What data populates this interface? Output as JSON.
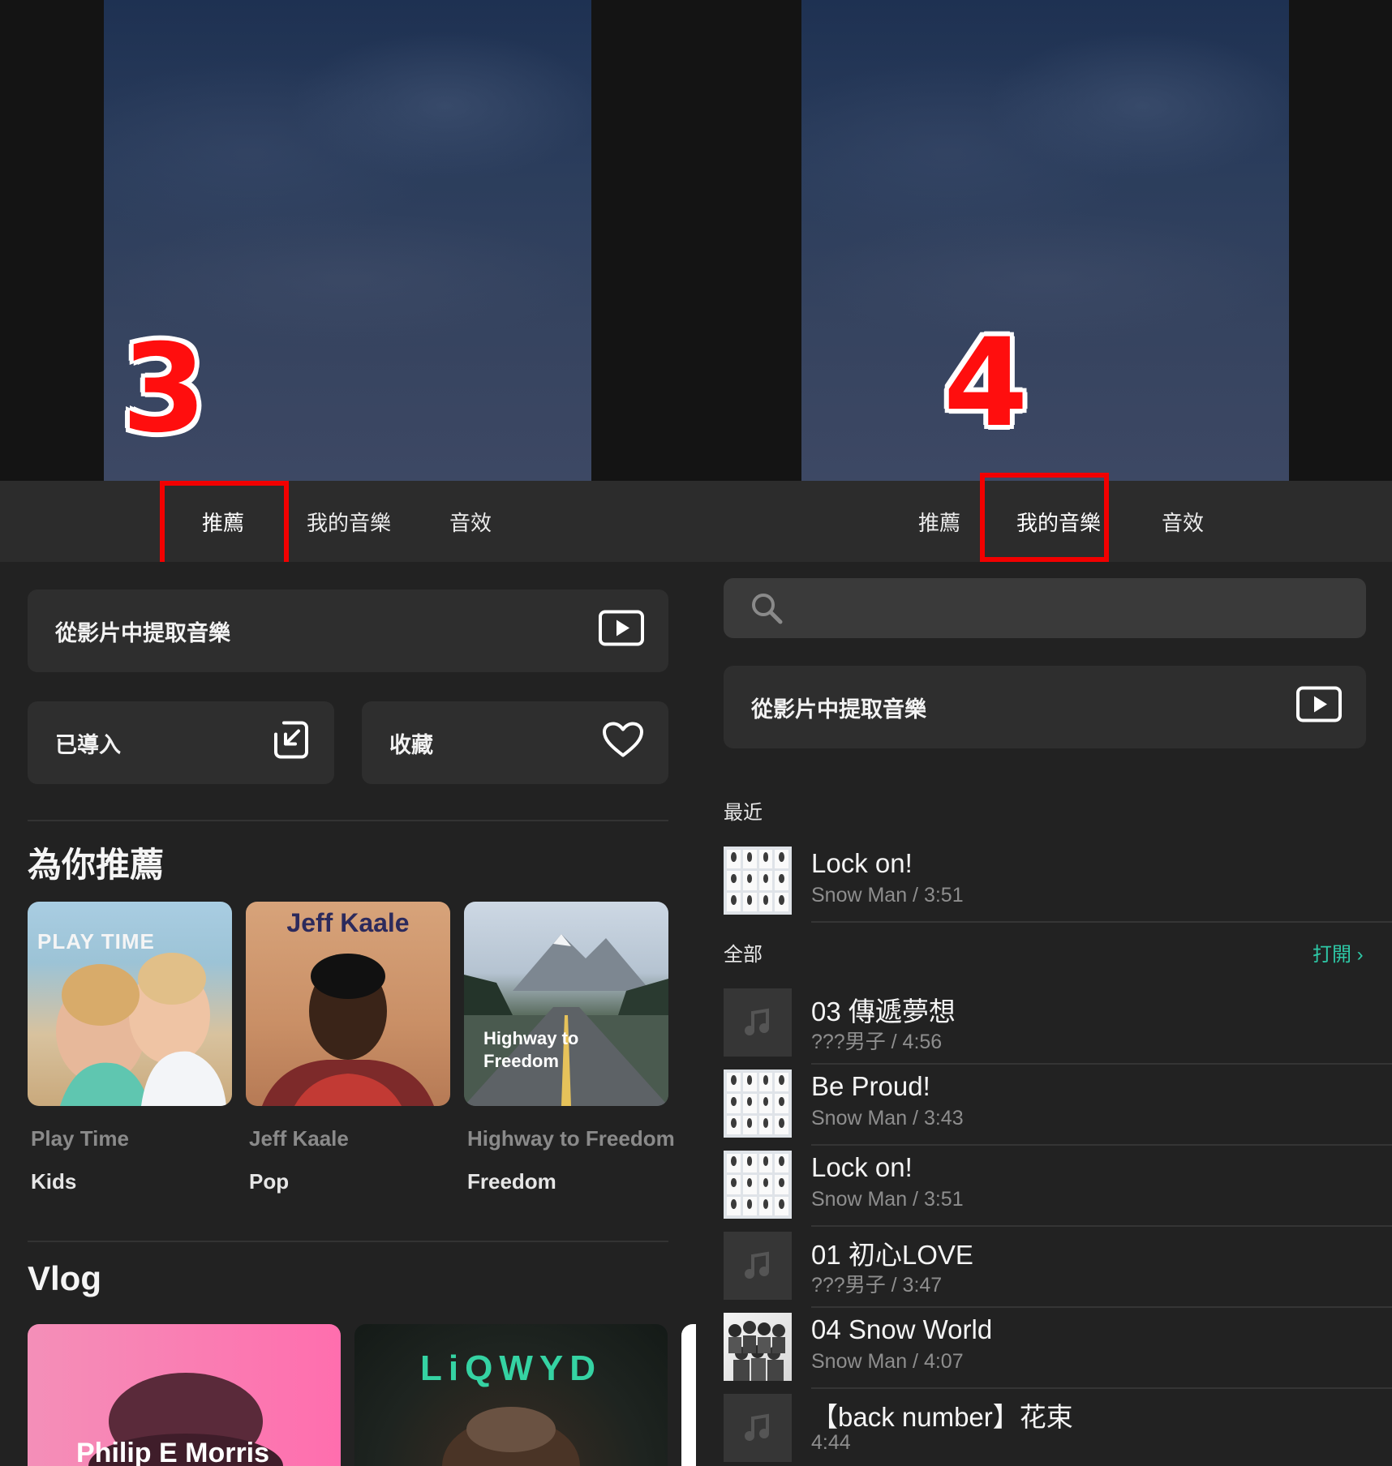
{
  "left": {
    "step_number": "3",
    "tabs": [
      "推薦",
      "我的音樂",
      "音效"
    ],
    "active_tab": "推薦",
    "extract_card": "從影片中提取音樂",
    "imported_card": "已導入",
    "favorites_card": "收藏",
    "recommend_title": "為你推薦",
    "albums": [
      {
        "cover_text": "PLAY TIME",
        "name": "Play Time",
        "genre": "Kids"
      },
      {
        "cover_text": "Jeff Kaale",
        "name": "Jeff Kaale",
        "genre": "Pop"
      },
      {
        "cover_text": "Highway to Freedom",
        "name": "Highway to Freedom",
        "genre": "Freedom"
      }
    ],
    "vlog_title": "Vlog",
    "vlog_cards": [
      {
        "cover_text": "Philip E Morris"
      },
      {
        "cover_text": "LiQWYD"
      }
    ]
  },
  "right": {
    "step_number": "4",
    "tabs": [
      "推薦",
      "我的音樂",
      "音效"
    ],
    "active_tab": "我的音樂",
    "search_icon": "search-icon",
    "extract_card": "從影片中提取音樂",
    "recent_label": "最近",
    "recent": [
      {
        "title": "Lock on!",
        "sub": "Snow Man / 3:51",
        "thumb": "grid"
      }
    ],
    "all_label": "全部",
    "open_link": "打開",
    "tracks": [
      {
        "title": "03 傳遞夢想",
        "sub": "???男子 / 4:56",
        "thumb": "note"
      },
      {
        "title": "Be Proud!",
        "sub": "Snow Man / 3:43",
        "thumb": "grid"
      },
      {
        "title": "Lock on!",
        "sub": "Snow Man / 3:51",
        "thumb": "grid"
      },
      {
        "title": "01 初心LOVE",
        "sub": "???男子 / 3:47",
        "thumb": "note"
      },
      {
        "title": "04 Snow World",
        "sub": "Snow Man / 4:07",
        "thumb": "group"
      },
      {
        "title": "【back number】花束",
        "sub": "4:44",
        "thumb": "note"
      }
    ]
  },
  "colors": {
    "accent_red": "#ff0e0e",
    "link_green": "#2ec9a7",
    "background": "#222222"
  }
}
